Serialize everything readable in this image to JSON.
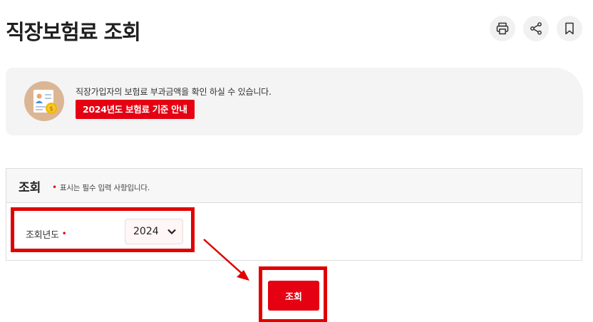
{
  "header": {
    "title": "직장보험료 조회",
    "tools": [
      {
        "icon": "printer-icon",
        "label": "print"
      },
      {
        "icon": "share-icon",
        "label": "share"
      },
      {
        "icon": "bookmark-icon",
        "label": "bookmark"
      }
    ]
  },
  "banner": {
    "description": "직장가입자의 보험료 부과금액을 확인 하실 수 있습니다.",
    "link_label": "2024년도 보험료 기준 안내"
  },
  "form": {
    "title": "조회",
    "required_mark": "•",
    "required_note": "표시는 필수 입력 사항입니다.",
    "year_field": {
      "label": "조회년도",
      "selected": "2024"
    },
    "submit_label": "조회"
  },
  "colors": {
    "accent": "#e50012",
    "highlight": "#e00000",
    "banner_bg": "#f4f4f5"
  }
}
